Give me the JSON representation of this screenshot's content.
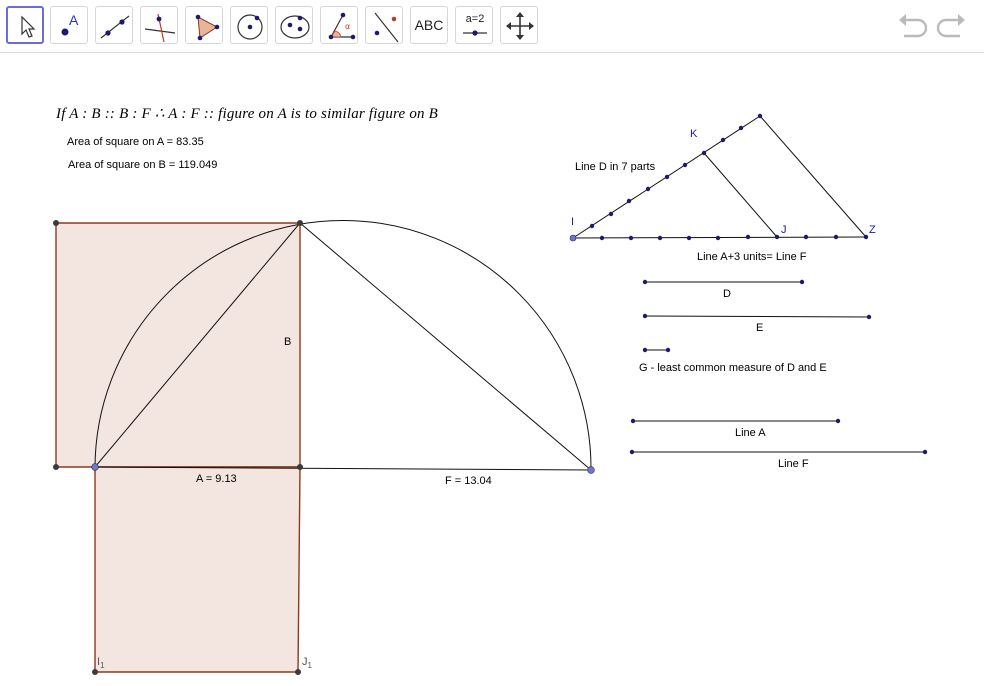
{
  "toolbar": {
    "tools": [
      {
        "name": "move-tool",
        "label": ""
      },
      {
        "name": "point-tool",
        "label": "A"
      },
      {
        "name": "line-tool",
        "label": ""
      },
      {
        "name": "perpendicular-tool",
        "label": ""
      },
      {
        "name": "polygon-tool",
        "label": ""
      },
      {
        "name": "circle-tool",
        "label": ""
      },
      {
        "name": "conic-tool",
        "label": ""
      },
      {
        "name": "angle-tool",
        "label": ""
      },
      {
        "name": "reflect-tool",
        "label": ""
      },
      {
        "name": "text-tool",
        "label": "ABC"
      },
      {
        "name": "slider-tool",
        "label": "a=2"
      },
      {
        "name": "move-view-tool",
        "label": ""
      }
    ]
  },
  "canvas": {
    "formula": "If A : B :: B : F  ∴  A : F :: figure on A is to similar figure on B",
    "area_a": "Area of square on A = 83.35",
    "area_b": "Area of square on B = 119.049",
    "label_b": "B",
    "label_a_len": "A = 9.13",
    "label_f_len": "F = 13.04",
    "label_i": "I",
    "label_j": "J",
    "label_k": "K",
    "label_z": "Z",
    "label_i1": "I",
    "label_i1_sub": "1",
    "label_j1": "J",
    "label_j1_sub": "1",
    "line_d_parts": "Line D in 7 parts",
    "line_a3": "Line A+3 units= Line F",
    "label_d": "D",
    "label_e": "E",
    "label_g": "G - least common measure of D and E",
    "label_line_a": "Line A",
    "label_line_f": "Line F"
  },
  "colors": {
    "square_fill": "#f3e6e1",
    "square_edge": "#8b3a1a",
    "point_dark": "#1a1a6e",
    "point_blue": "#6e74d8",
    "label_blue": "#1a1aa8"
  }
}
